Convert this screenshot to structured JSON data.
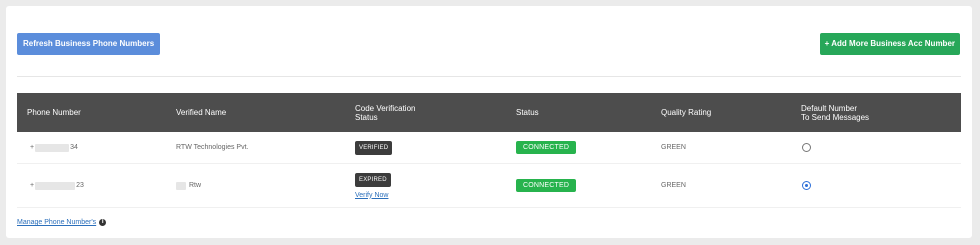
{
  "toolbar": {
    "refresh_label": "Refresh Business Phone Numbers",
    "add_label": "+ Add More Business Acc Number"
  },
  "table": {
    "headers": {
      "phone": "Phone Number",
      "name": "Verified Name",
      "code_line1": "Code Verification",
      "code_line2": "Status",
      "status": "Status",
      "quality": "Quality Rating",
      "default_line1": "Default Number",
      "default_line2": "To Send Messages"
    },
    "rows": [
      {
        "phone_prefix": "+",
        "phone_suffix": "34",
        "verified_name": "RTW Technologies Pvt.",
        "code_status": "VERIFIED",
        "code_link": "",
        "status": "CONNECTED",
        "quality": "GREEN",
        "is_default": false
      },
      {
        "phone_prefix": "+",
        "phone_suffix": "23",
        "verified_name": "Rtw",
        "code_status": "EXPIRED",
        "code_link": "Verify Now",
        "status": "CONNECTED",
        "quality": "GREEN",
        "is_default": true
      }
    ]
  },
  "footer": {
    "manage_link": "Manage Phone Number's",
    "info_icon": "info-icon"
  },
  "colors": {
    "refresh_button": "#5b8ddb",
    "add_button": "#27a759",
    "header_bg": "#4d4d4d",
    "connected_badge": "#27b34d",
    "code_badge": "#3c3c3c",
    "link": "#2b6fbb"
  }
}
